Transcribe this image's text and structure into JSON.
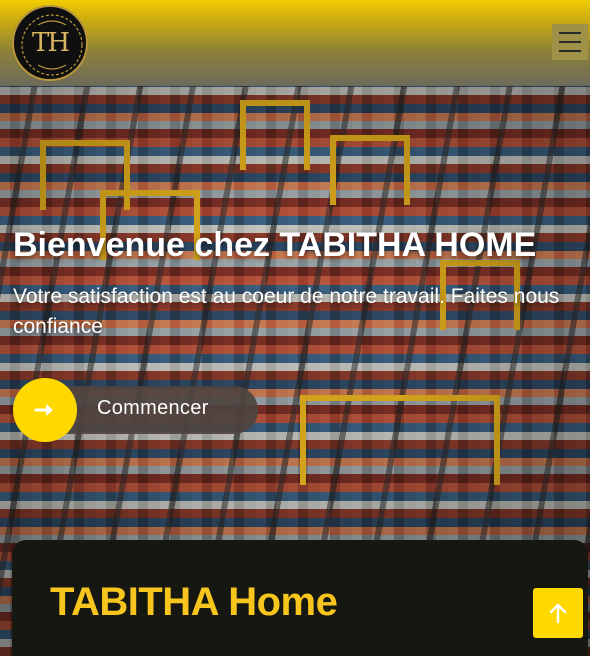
{
  "brand": {
    "logo_monogram": "TH",
    "logo_icon": "monogram-logo"
  },
  "nav": {
    "menu_icon": "hamburger-menu-icon"
  },
  "hero": {
    "title": "Bienvenue chez TABITHA HOME",
    "subtitle": "Votre satisfaction est au coeur de notre travail. Faites nous confiance",
    "background_description_icon": "container-port-image"
  },
  "cta": {
    "label": "Commencer",
    "icon": "arrow-right-icon"
  },
  "section": {
    "title": "TABITHA Home"
  },
  "scroll_top": {
    "icon": "arrow-up-icon"
  },
  "colors": {
    "accent_yellow": "#ffd800",
    "title_yellow": "#f7c51c",
    "card_bg": "#171712",
    "navbar_top": "#f2cc00"
  }
}
